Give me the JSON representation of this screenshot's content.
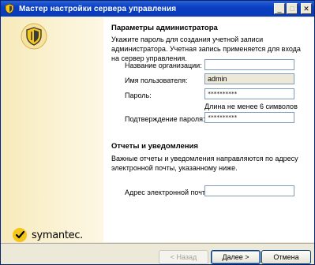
{
  "window": {
    "title": "Мастер настройки сервера управления",
    "minimize": "_",
    "maximize": "□",
    "close": "✕"
  },
  "brand": {
    "logo_text": "symantec.",
    "accent": "#f0c419"
  },
  "admin": {
    "section_title": "Параметры администратора",
    "description": "Укажите пароль для создания учетной записи администратора. Учетная запись применяется для входа на сервер управления.",
    "org_label": "Название организации:",
    "org_value": "",
    "user_label": "Имя пользователя:",
    "user_value": "admin",
    "password_label": "Пароль:",
    "password_value": "**********",
    "password_hint": "Длина не менее 6 символов",
    "confirm_label": "Подтверждение пароля:",
    "confirm_value": "**********"
  },
  "reports": {
    "section_title": "Отчеты и уведомления",
    "description": "Важные отчеты и уведомления направляются по адресу электронной почты, указанному ниже.",
    "email_label": "Адрес электронной почты:",
    "email_value": ""
  },
  "buttons": {
    "back": "< Назад",
    "next": "Далее >",
    "cancel": "Отмена"
  }
}
